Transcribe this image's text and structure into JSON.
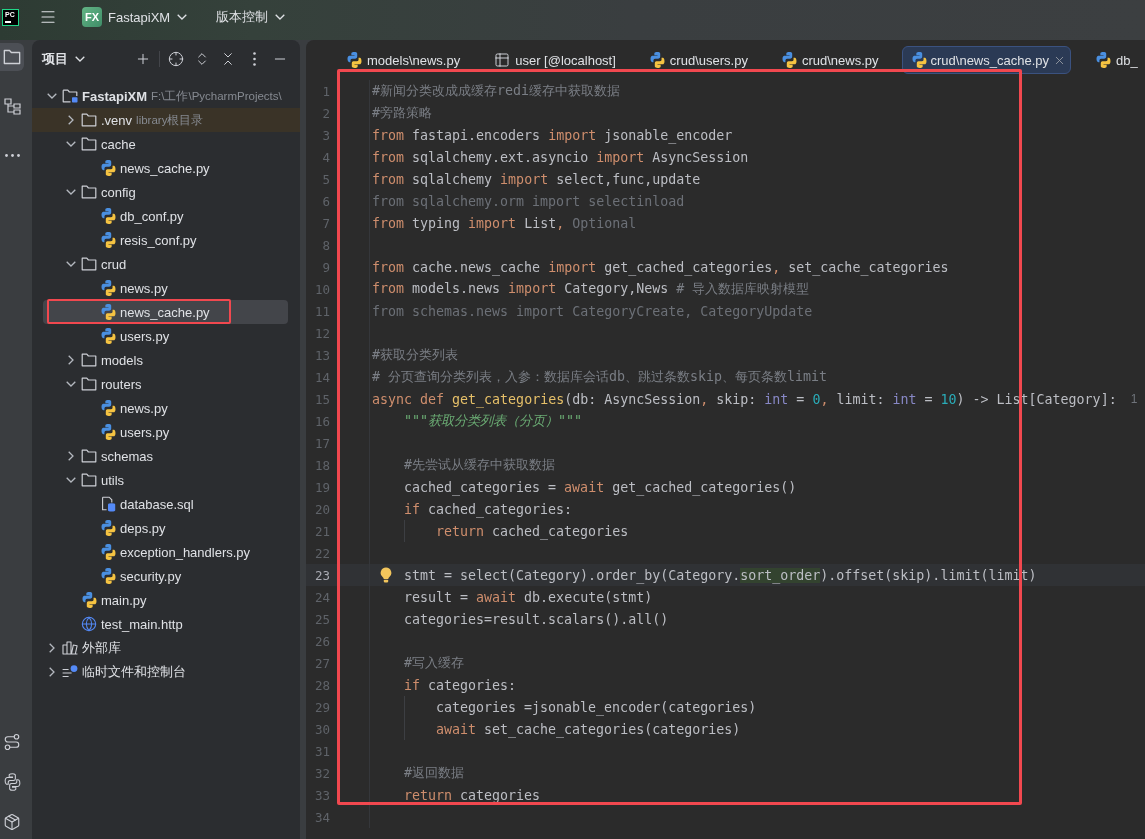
{
  "title_bar": {
    "app_logo": "PC",
    "project_badge": "FX",
    "project": "FastapiXM",
    "vcs": "版本控制"
  },
  "tool_windows": [
    {
      "kind": "project",
      "selected": true
    },
    {
      "kind": "structure",
      "selected": false
    },
    {
      "kind": "more",
      "selected": false
    }
  ],
  "tool_windows_bottom": [
    {
      "kind": "vcs",
      "selected": false
    },
    {
      "kind": "python_console",
      "selected": false
    },
    {
      "kind": "services",
      "selected": false
    }
  ],
  "project_panel": {
    "title": "项目",
    "tree": [
      {
        "kind": "root",
        "label": "FastapiXM",
        "note": "F:\\工作\\PycharmProjects\\",
        "expanded": true,
        "selected": false,
        "children": [
          {
            "kind": "library_root",
            "label": ".venv",
            "note": "library根目录",
            "expanded": false,
            "selected": false
          },
          {
            "kind": "folder",
            "label": "cache",
            "expanded": true,
            "selected": false,
            "children": [
              {
                "kind": "python",
                "label": "news_cache.py",
                "selected": false
              }
            ]
          },
          {
            "kind": "folder",
            "label": "config",
            "expanded": true,
            "selected": false,
            "children": [
              {
                "kind": "python",
                "label": "db_conf.py",
                "selected": false
              },
              {
                "kind": "python",
                "label": "resis_conf.py",
                "selected": false
              }
            ]
          },
          {
            "kind": "folder",
            "label": "crud",
            "expanded": true,
            "selected": false,
            "children": [
              {
                "kind": "python",
                "label": "news.py",
                "selected": false
              },
              {
                "kind": "python",
                "label": "news_cache.py",
                "selected": true
              },
              {
                "kind": "python",
                "label": "users.py",
                "selected": false
              }
            ]
          },
          {
            "kind": "folder",
            "label": "models",
            "expanded": false,
            "selected": false
          },
          {
            "kind": "folder",
            "label": "routers",
            "expanded": true,
            "selected": false,
            "children": [
              {
                "kind": "python",
                "label": "news.py",
                "selected": false
              },
              {
                "kind": "python",
                "label": "users.py",
                "selected": false
              }
            ]
          },
          {
            "kind": "folder",
            "label": "schemas",
            "expanded": false,
            "selected": false
          },
          {
            "kind": "folder",
            "label": "utils",
            "expanded": true,
            "selected": false,
            "children": [
              {
                "kind": "sql",
                "label": "database.sql",
                "selected": false
              },
              {
                "kind": "python",
                "label": "deps.py",
                "selected": false
              },
              {
                "kind": "python",
                "label": "exception_handlers.py",
                "selected": false
              },
              {
                "kind": "python",
                "label": "security.py",
                "selected": false
              }
            ]
          },
          {
            "kind": "python",
            "label": "main.py",
            "selected": false
          },
          {
            "kind": "http",
            "label": "test_main.http",
            "selected": false
          }
        ]
      },
      {
        "kind": "libraries",
        "label": "外部库",
        "expanded": false,
        "selected": false
      },
      {
        "kind": "scratches",
        "label": "临时文件和控制台",
        "expanded": false,
        "selected": false
      }
    ]
  },
  "editor": {
    "tabs": [
      {
        "kind": "python",
        "label": "models\\news.py",
        "selected": false
      },
      {
        "kind": "table",
        "label": "user [@localhost]",
        "selected": false
      },
      {
        "kind": "python",
        "label": "crud\\users.py",
        "selected": false
      },
      {
        "kind": "python",
        "label": "crud\\news.py",
        "selected": false
      },
      {
        "kind": "python",
        "label": "crud\\news_cache.py",
        "selected": true
      },
      {
        "kind": "python",
        "label": "db_",
        "selected": false
      }
    ],
    "lines": [
      {
        "number": "1",
        "current": false,
        "bulb": false,
        "tokens": [
          {
            "kind": "comment",
            "text": "#新闻分类改成成缓存redi缓存中获取数据"
          }
        ]
      },
      {
        "number": "2",
        "current": false,
        "bulb": false,
        "tokens": [
          {
            "kind": "comment",
            "text": "#旁路策略"
          }
        ]
      },
      {
        "number": "3",
        "current": false,
        "bulb": false,
        "tokens": [
          {
            "kind": "keyword",
            "text": "from"
          },
          {
            "kind": "plain",
            "text": " fastapi.encoders "
          },
          {
            "kind": "keyword",
            "text": "import"
          },
          {
            "kind": "plain",
            "text": " jsonable_encoder"
          }
        ]
      },
      {
        "number": "4",
        "current": false,
        "bulb": false,
        "tokens": [
          {
            "kind": "keyword",
            "text": "from"
          },
          {
            "kind": "plain",
            "text": " sqlalchemy.ext.asyncio "
          },
          {
            "kind": "keyword",
            "text": "import"
          },
          {
            "kind": "plain",
            "text": " AsyncSession"
          }
        ]
      },
      {
        "number": "5",
        "current": false,
        "bulb": false,
        "tokens": [
          {
            "kind": "keyword",
            "text": "from"
          },
          {
            "kind": "plain",
            "text": " sqlalchemy "
          },
          {
            "kind": "keyword",
            "text": "import"
          },
          {
            "kind": "plain",
            "text": " select,func,update"
          }
        ]
      },
      {
        "number": "6",
        "current": false,
        "bulb": false,
        "tokens": [
          {
            "kind": "unused",
            "text": "from sqlalchemy.orm import selectinload"
          }
        ]
      },
      {
        "number": "7",
        "current": false,
        "bulb": false,
        "tokens": [
          {
            "kind": "keyword",
            "text": "from"
          },
          {
            "kind": "plain",
            "text": " typing "
          },
          {
            "kind": "keyword",
            "text": "import"
          },
          {
            "kind": "plain",
            "text": " List"
          },
          {
            "kind": "punct",
            "text": ","
          },
          {
            "kind": "unused",
            "text": " Optional"
          }
        ]
      },
      {
        "number": "8",
        "current": false,
        "bulb": false
      },
      {
        "number": "9",
        "current": false,
        "bulb": false,
        "tokens": [
          {
            "kind": "keyword",
            "text": "from"
          },
          {
            "kind": "plain",
            "text": " cache.news_cache "
          },
          {
            "kind": "keyword",
            "text": "import"
          },
          {
            "kind": "plain",
            "text": " get_cached_categories"
          },
          {
            "kind": "punct",
            "text": ","
          },
          {
            "kind": "plain",
            "text": " set_cache_categories"
          }
        ]
      },
      {
        "number": "10",
        "current": false,
        "bulb": false,
        "tokens": [
          {
            "kind": "keyword",
            "text": "from"
          },
          {
            "kind": "plain",
            "text": " models.news "
          },
          {
            "kind": "keyword",
            "text": "import"
          },
          {
            "kind": "plain",
            "text": " Category,News "
          },
          {
            "kind": "comment",
            "text": "# 导入数据库映射模型"
          }
        ]
      },
      {
        "number": "11",
        "current": false,
        "bulb": false,
        "tokens": [
          {
            "kind": "unused",
            "text": "from schemas.news import CategoryCreate, CategoryUpdate"
          }
        ]
      },
      {
        "number": "12",
        "current": false,
        "bulb": false
      },
      {
        "number": "13",
        "current": false,
        "bulb": false,
        "tokens": [
          {
            "kind": "comment",
            "text": "#获取分类列表"
          }
        ]
      },
      {
        "number": "14",
        "current": false,
        "bulb": false,
        "tokens": [
          {
            "kind": "comment",
            "text": "# 分页查询分类列表，入参：数据库会话db、跳过条数skip、每页条数limit"
          }
        ]
      },
      {
        "number": "15",
        "current": false,
        "bulb": false,
        "hint": "1",
        "tokens": [
          {
            "kind": "keyword",
            "text": "async "
          },
          {
            "kind": "keyword",
            "text": "def "
          },
          {
            "kind": "function",
            "text": "get_categories"
          },
          {
            "kind": "plain",
            "text": "(db: AsyncSession"
          },
          {
            "kind": "punct",
            "text": ","
          },
          {
            "kind": "plain",
            "text": " skip: "
          },
          {
            "kind": "builtin",
            "text": "int"
          },
          {
            "kind": "plain",
            "text": " = "
          },
          {
            "kind": "number",
            "text": "0"
          },
          {
            "kind": "punct",
            "text": ","
          },
          {
            "kind": "plain",
            "text": " limit: "
          },
          {
            "kind": "builtin",
            "text": "int"
          },
          {
            "kind": "plain",
            "text": " = "
          },
          {
            "kind": "number",
            "text": "10"
          },
          {
            "kind": "plain",
            "text": ") -> List[Category]:"
          }
        ]
      },
      {
        "number": "16",
        "current": false,
        "bulb": false,
        "tokens": [
          {
            "kind": "docstring",
            "text": "    \"\"\"获取分类列表（分页）\"\"\""
          }
        ]
      },
      {
        "number": "17",
        "current": false,
        "bulb": false
      },
      {
        "number": "18",
        "current": false,
        "bulb": false,
        "tokens": [
          {
            "kind": "comment",
            "text": "    #先尝试从缓存中获取数据"
          }
        ]
      },
      {
        "number": "19",
        "current": false,
        "bulb": false,
        "tokens": [
          {
            "kind": "plain",
            "text": "    cached_categories = "
          },
          {
            "kind": "keyword",
            "text": "await"
          },
          {
            "kind": "plain",
            "text": " get_cached_categories()"
          }
        ]
      },
      {
        "number": "20",
        "current": false,
        "bulb": false,
        "tokens": [
          {
            "kind": "keyword",
            "text": "    if"
          },
          {
            "kind": "plain",
            "text": " cached_categories:"
          }
        ]
      },
      {
        "number": "21",
        "current": false,
        "bulb": false,
        "tokens": [
          {
            "kind": "keyword",
            "text": "        return"
          },
          {
            "kind": "plain",
            "text": " cached_categories"
          }
        ]
      },
      {
        "number": "22",
        "current": false,
        "bulb": false
      },
      {
        "number": "23",
        "current": true,
        "bulb": true,
        "tokens": [
          {
            "kind": "plain",
            "text": "    stmt = select(Category).order_by(Category."
          },
          {
            "kind": "match",
            "text": "sort_order"
          },
          {
            "kind": "plain",
            "text": ").offset(skip).limit(limit)"
          }
        ]
      },
      {
        "number": "24",
        "current": false,
        "bulb": false,
        "tokens": [
          {
            "kind": "plain",
            "text": "    result = "
          },
          {
            "kind": "keyword",
            "text": "await"
          },
          {
            "kind": "plain",
            "text": " db.execute(stmt)"
          }
        ]
      },
      {
        "number": "25",
        "current": false,
        "bulb": false,
        "tokens": [
          {
            "kind": "plain",
            "text": "    categories=result.scalars().all()"
          }
        ]
      },
      {
        "number": "26",
        "current": false,
        "bulb": false
      },
      {
        "number": "27",
        "current": false,
        "bulb": false,
        "tokens": [
          {
            "kind": "comment",
            "text": "    #写入缓存"
          }
        ]
      },
      {
        "number": "28",
        "current": false,
        "bulb": false,
        "tokens": [
          {
            "kind": "keyword",
            "text": "    if"
          },
          {
            "kind": "plain",
            "text": " categories:"
          }
        ]
      },
      {
        "number": "29",
        "current": false,
        "bulb": false,
        "tokens": [
          {
            "kind": "plain",
            "text": "        categories =jsonable_encoder(categories)"
          }
        ]
      },
      {
        "number": "30",
        "current": false,
        "bulb": false,
        "tokens": [
          {
            "kind": "keyword",
            "text": "        await"
          },
          {
            "kind": "plain",
            "text": " set_cache_categories(categories)"
          }
        ]
      },
      {
        "number": "31",
        "current": false,
        "bulb": false
      },
      {
        "number": "32",
        "current": false,
        "bulb": false,
        "tokens": [
          {
            "kind": "comment",
            "text": "    #返回数据"
          }
        ]
      },
      {
        "number": "33",
        "current": false,
        "bulb": false,
        "tokens": [
          {
            "kind": "keyword",
            "text": "    return"
          },
          {
            "kind": "plain",
            "text": " categories"
          }
        ]
      },
      {
        "number": "34",
        "current": false,
        "bulb": false
      }
    ]
  }
}
